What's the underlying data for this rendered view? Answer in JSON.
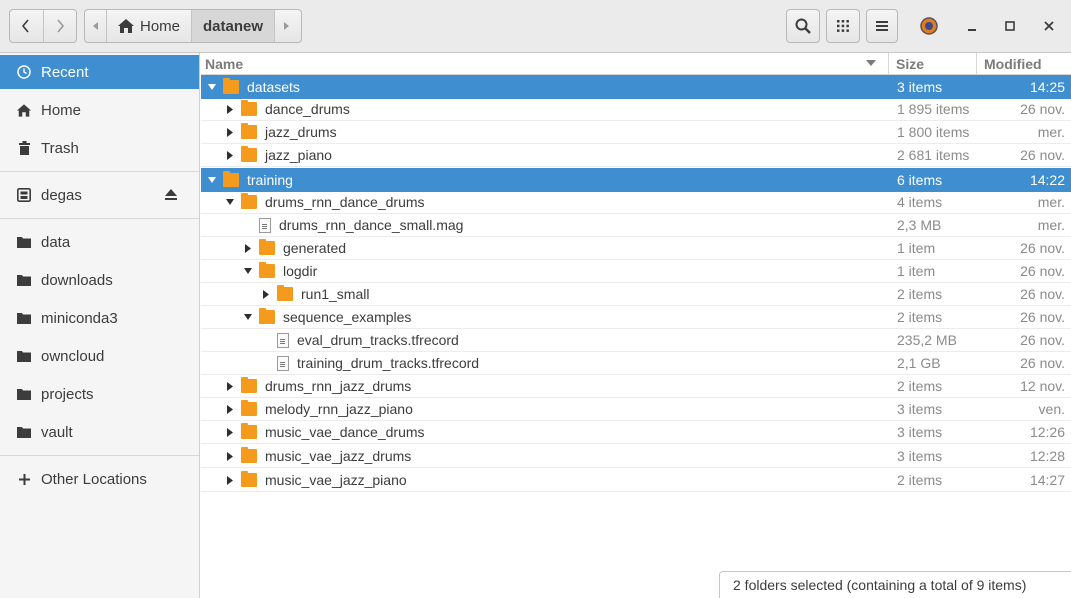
{
  "header": {
    "back_label": "Back",
    "forward_label": "Forward",
    "path": [
      {
        "label": "Home",
        "icon": "home-icon"
      },
      {
        "label": "datanew",
        "icon": ""
      }
    ]
  },
  "sidebar": {
    "items": [
      {
        "label": "Recent",
        "icon": "clock-icon",
        "selected": true
      },
      {
        "label": "Home",
        "icon": "home-icon"
      },
      {
        "label": "Trash",
        "icon": "trash-icon"
      },
      {
        "label": "degas",
        "icon": "drive-icon"
      },
      {
        "label": "data",
        "icon": "folder-icon"
      },
      {
        "label": "downloads",
        "icon": "folder-icon"
      },
      {
        "label": "miniconda3",
        "icon": "folder-icon"
      },
      {
        "label": "owncloud",
        "icon": "folder-icon"
      },
      {
        "label": "projects",
        "icon": "folder-icon"
      },
      {
        "label": "vault",
        "icon": "folder-icon"
      },
      {
        "label": "Other Locations",
        "icon": "plus-icon"
      }
    ]
  },
  "columns": {
    "name": "Name",
    "size": "Size",
    "modified": "Modified"
  },
  "rows": [
    {
      "name": "datasets",
      "size": "3 items",
      "modified": "14:25",
      "type": "folder",
      "level": 0,
      "expanded": true,
      "selected": true
    },
    {
      "name": "dance_drums",
      "size": "1 895 items",
      "modified": "26 nov.",
      "type": "folder",
      "level": 1,
      "expanded": false
    },
    {
      "name": "jazz_drums",
      "size": "1 800 items",
      "modified": "mer.",
      "type": "folder",
      "level": 1,
      "expanded": false
    },
    {
      "name": "jazz_piano",
      "size": "2 681 items",
      "modified": "26 nov.",
      "type": "folder",
      "level": 1,
      "expanded": false
    },
    {
      "name": "training",
      "size": "6 items",
      "modified": "14:22",
      "type": "folder",
      "level": 0,
      "expanded": true,
      "selected": true
    },
    {
      "name": "drums_rnn_dance_drums",
      "size": "4 items",
      "modified": "mer.",
      "type": "folder",
      "level": 1,
      "expanded": true
    },
    {
      "name": "drums_rnn_dance_small.mag",
      "size": "2,3 MB",
      "modified": "mer.",
      "type": "file",
      "level": 2
    },
    {
      "name": "generated",
      "size": "1 item",
      "modified": "26 nov.",
      "type": "folder",
      "level": 2,
      "expanded": false
    },
    {
      "name": "logdir",
      "size": "1 item",
      "modified": "26 nov.",
      "type": "folder",
      "level": 2,
      "expanded": true
    },
    {
      "name": "run1_small",
      "size": "2 items",
      "modified": "26 nov.",
      "type": "folder",
      "level": 3,
      "expanded": false
    },
    {
      "name": "sequence_examples",
      "size": "2 items",
      "modified": "26 nov.",
      "type": "folder",
      "level": 2,
      "expanded": true
    },
    {
      "name": "eval_drum_tracks.tfrecord",
      "size": "235,2 MB",
      "modified": "26 nov.",
      "type": "file",
      "level": 3
    },
    {
      "name": "training_drum_tracks.tfrecord",
      "size": "2,1 GB",
      "modified": "26 nov.",
      "type": "file",
      "level": 3
    },
    {
      "name": "drums_rnn_jazz_drums",
      "size": "2 items",
      "modified": "12 nov.",
      "type": "folder",
      "level": 1,
      "expanded": false
    },
    {
      "name": "melody_rnn_jazz_piano",
      "size": "3 items",
      "modified": "ven.",
      "type": "folder",
      "level": 1,
      "expanded": false
    },
    {
      "name": "music_vae_dance_drums",
      "size": "3 items",
      "modified": "12:26",
      "type": "folder",
      "level": 1,
      "expanded": false
    },
    {
      "name": "music_vae_jazz_drums",
      "size": "3 items",
      "modified": "12:28",
      "type": "folder",
      "level": 1,
      "expanded": false
    },
    {
      "name": "music_vae_jazz_piano",
      "size": "2 items",
      "modified": "14:27",
      "type": "folder",
      "level": 1,
      "expanded": false
    }
  ],
  "status": "2 folders selected  (containing a total of 9 items)",
  "colors": {
    "selection": "#3e8ed0",
    "folder": "#f49b1e"
  }
}
